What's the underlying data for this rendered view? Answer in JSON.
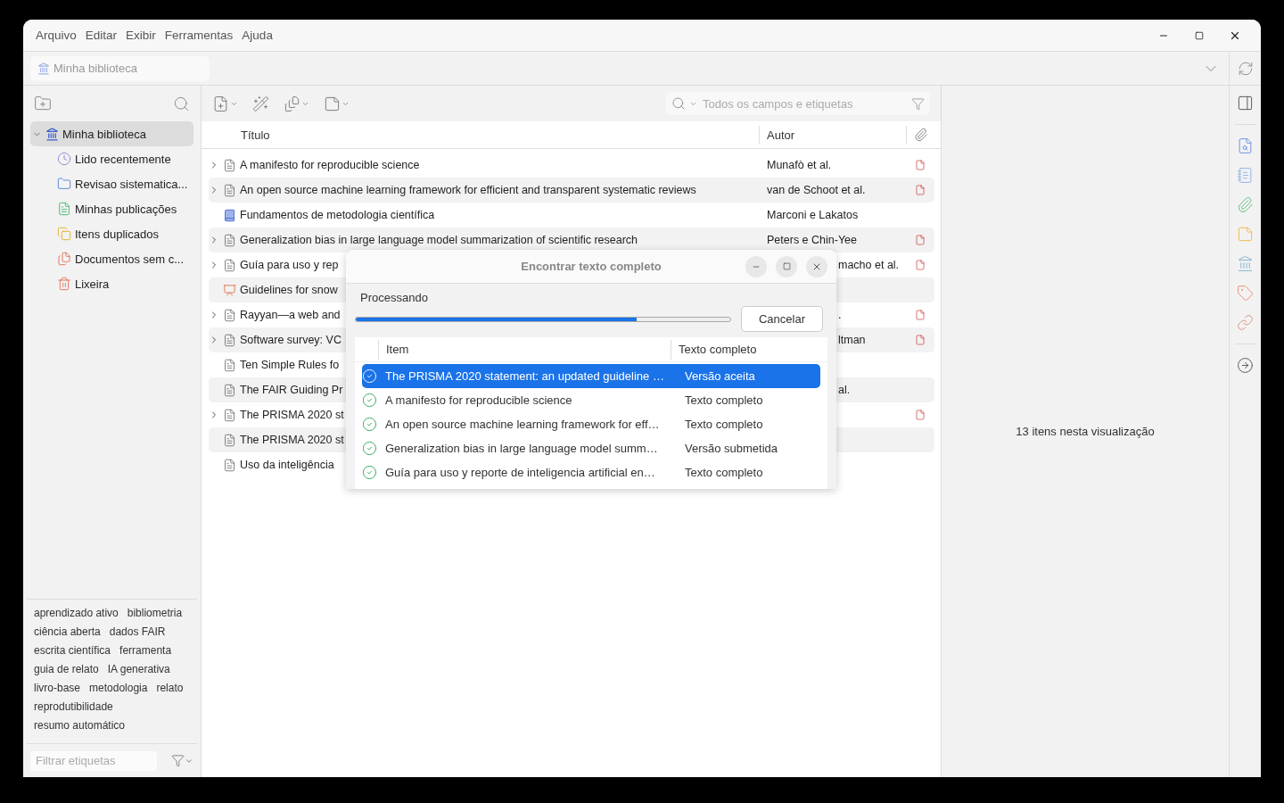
{
  "menu": [
    "Arquivo",
    "Editar",
    "Exibir",
    "Ferramentas",
    "Ajuda"
  ],
  "breadcrumb": "Minha biblioteca",
  "collections": {
    "label": "Minha biblioteca",
    "expanded": true,
    "selected": true,
    "children": [
      {
        "label": "Lido recentemente",
        "kind": "recent",
        "selected": false
      },
      {
        "label": "Revisao sistematica...",
        "kind": "folder",
        "selected": false
      },
      {
        "label": "Minhas publicações",
        "kind": "publications",
        "selected": false
      },
      {
        "label": "Itens duplicados",
        "kind": "duplicates",
        "selected": false
      },
      {
        "label": "Documentos sem c...",
        "kind": "unfiled",
        "selected": false
      },
      {
        "label": "Lixeira",
        "kind": "trash",
        "selected": false
      }
    ]
  },
  "tags": [
    "aprendizado ativo",
    "bibliometria",
    "ciência aberta",
    "dados FAIR",
    "escrita científica",
    "ferramenta",
    "guia de relato",
    "IA generativa",
    "livro-base",
    "metodologia",
    "relato",
    "reprodutibilidade",
    "resumo automático"
  ],
  "tag_filter": {
    "placeholder": "Filtrar etiquetas"
  },
  "search": {
    "placeholder": "Todos os campos e etiquetas"
  },
  "table": {
    "columns": [
      "Título",
      "Autor"
    ],
    "rows": [
      {
        "title": "A manifesto for reproducible science",
        "author": "Munafò et al.",
        "kind": "document",
        "expandable": true,
        "attachment": true
      },
      {
        "title": "An open source machine learning framework for efficient and transparent systematic reviews",
        "author": "van de Schoot et al.",
        "kind": "document",
        "expandable": true,
        "attachment": true
      },
      {
        "title": "Fundamentos de metodologia científica",
        "author": "Marconi e Lakatos",
        "kind": "book",
        "expandable": false,
        "attachment": false
      },
      {
        "title": "Generalization bias in large language model summarization of scientific research",
        "author": "Peters e Chin-Yee",
        "kind": "document",
        "expandable": true,
        "attachment": true
      },
      {
        "title": "Guía para uso y rep",
        "author_end": "macho et al.",
        "kind": "document",
        "expandable": true,
        "attachment": true
      },
      {
        "title": "Guidelines for snow",
        "kind": "presentation",
        "expandable": false,
        "attachment": false
      },
      {
        "title": "Rayyan—a web and",
        "author_end": ".",
        "kind": "document",
        "expandable": true,
        "attachment": true
      },
      {
        "title": "Software survey: VC",
        "author_end": "ltman",
        "kind": "document",
        "expandable": true,
        "attachment": true
      },
      {
        "title": "Ten Simple Rules fo",
        "kind": "document",
        "expandable": false,
        "attachment": false
      },
      {
        "title": "The FAIR Guiding Pr",
        "author_end": "al.",
        "kind": "document",
        "expandable": false,
        "attachment": false
      },
      {
        "title": "The PRISMA 2020 st",
        "kind": "document",
        "expandable": true,
        "attachment": true
      },
      {
        "title": "The PRISMA 2020 st",
        "kind": "document",
        "expandable": false,
        "attachment": false
      },
      {
        "title": "Uso da inteligência",
        "kind": "document",
        "expandable": false,
        "attachment": false
      }
    ]
  },
  "item_pane": {
    "message": "13 itens nesta visualização"
  },
  "dialog": {
    "title": "Encontrar texto completo",
    "status": "Processando",
    "level": 0.75,
    "cancel": "Cancelar",
    "columns": [
      "Item",
      "Texto completo"
    ],
    "rows": [
      {
        "item": "The PRISMA 2020 statement: an updated guideline …",
        "result": "Versão aceita",
        "selected": true
      },
      {
        "item": "A manifesto for reproducible science",
        "result": "Texto completo",
        "selected": false
      },
      {
        "item": "An open source machine learning framework for eff…",
        "result": "Texto completo",
        "selected": false
      },
      {
        "item": "Generalization bias in large language model summ…",
        "result": "Versão submetida",
        "selected": false
      },
      {
        "item": "Guía para uso y reporte de inteligencia artificial en…",
        "result": "Texto completo",
        "selected": false
      }
    ]
  }
}
